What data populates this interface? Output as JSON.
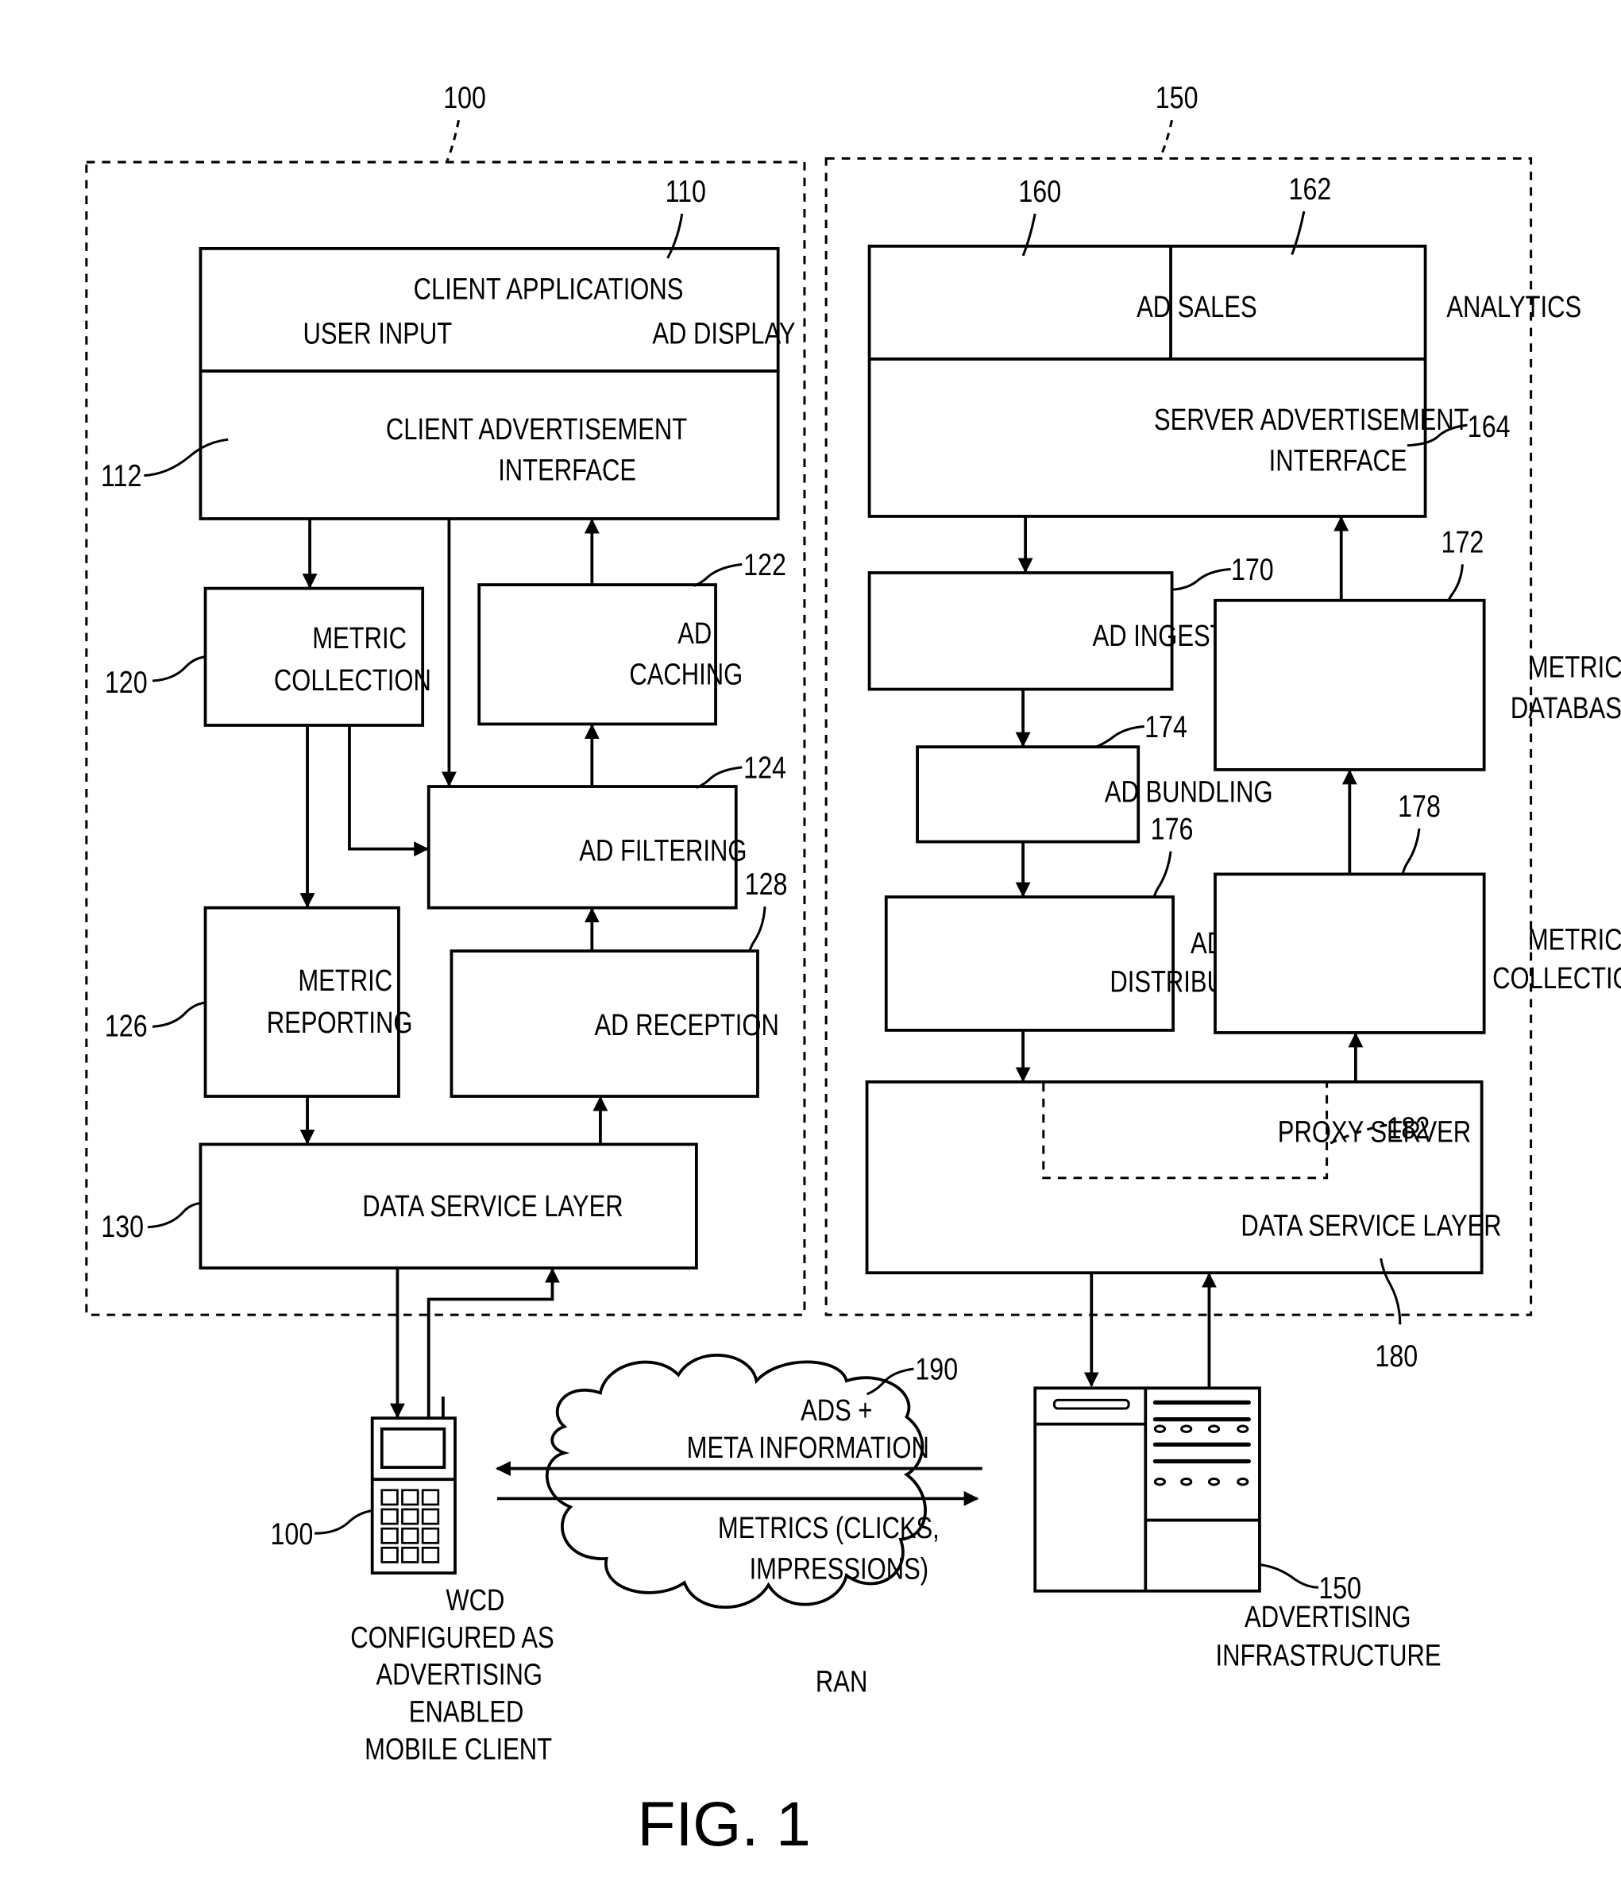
{
  "figure": {
    "caption": "FIG. 1"
  },
  "client_side": {
    "ref": "100",
    "client_applications": {
      "ref": "110",
      "title": "CLIENT APPLICATIONS",
      "left_item": "USER INPUT",
      "right_item": "AD DISPLAY"
    },
    "client_ad_interface": {
      "ref": "112",
      "line1": "CLIENT ADVERTISEMENT",
      "line2": "INTERFACE"
    },
    "metric_collection": {
      "ref": "120",
      "line1": "METRIC",
      "line2": "COLLECTION"
    },
    "ad_caching": {
      "ref": "122",
      "line1": "AD",
      "line2": "CACHING"
    },
    "ad_filtering": {
      "ref": "124",
      "label": "AD FILTERING"
    },
    "metric_reporting": {
      "ref": "126",
      "line1": "METRIC",
      "line2": "REPORTING"
    },
    "ad_reception": {
      "ref": "128",
      "label": "AD RECEPTION"
    },
    "data_service_layer": {
      "ref": "130",
      "label": "DATA SERVICE LAYER"
    }
  },
  "server_side": {
    "ref": "150",
    "ad_sales": {
      "ref": "160",
      "label": "AD SALES"
    },
    "analytics": {
      "ref": "162",
      "label": "ANALYTICS"
    },
    "server_ad_interface": {
      "ref": "164",
      "line1": "SERVER ADVERTISEMENT",
      "line2": "INTERFACE"
    },
    "ad_ingestion": {
      "ref": "170",
      "label": "AD INGESTION"
    },
    "metric_database": {
      "ref": "172",
      "line1": "METRIC",
      "line2": "DATABASE"
    },
    "ad_bundling": {
      "ref": "174",
      "label": "AD BUNDLING"
    },
    "ad_distribution": {
      "ref": "176",
      "line1": "AD",
      "line2": "DISTRIBUTION"
    },
    "metric_collection": {
      "ref": "178",
      "line1": "METRIC",
      "line2": "COLLECTION"
    },
    "data_service_layer": {
      "ref": "180",
      "label": "DATA SERVICE LAYER"
    },
    "proxy_server": {
      "ref": "182",
      "label": "PROXY SERVER"
    }
  },
  "network": {
    "ref": "190",
    "downlink_line1": "ADS +",
    "downlink_line2": "META INFORMATION",
    "uplink_line1": "METRICS (CLICKS,",
    "uplink_line2": "IMPRESSIONS)",
    "name": "RAN"
  },
  "mobile_client": {
    "ref": "100",
    "caption_lines": [
      "WCD",
      "CONFIGURED AS",
      "ADVERTISING",
      "ENABLED",
      "MOBILE CLIENT"
    ],
    "icon": "mobile-phone-icon"
  },
  "infrastructure": {
    "ref": "150",
    "caption_lines": [
      "ADVERTISING",
      "INFRASTRUCTURE"
    ],
    "icon": "server-rack-icon"
  }
}
